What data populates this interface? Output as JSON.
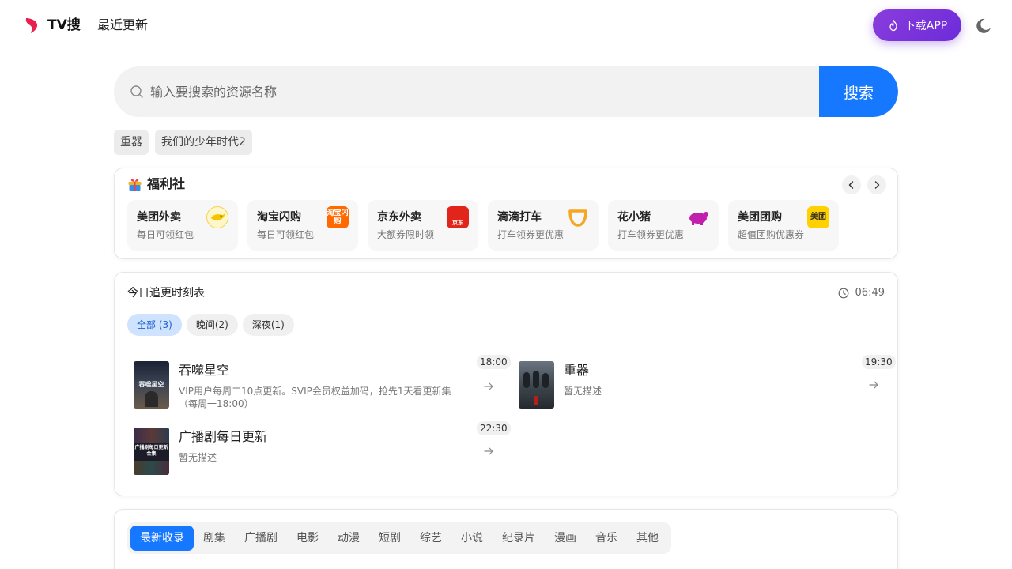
{
  "header": {
    "brand": "TV搜",
    "nav_recent": "最近更新",
    "download_label": "下载APP"
  },
  "search": {
    "placeholder": "输入要搜索的资源名称",
    "button": "搜索",
    "tags": [
      "重器",
      "我们的少年时代2"
    ]
  },
  "welfare": {
    "title": "福利社",
    "items": [
      {
        "name": "美团外卖",
        "desc": "每日可领红包",
        "logo": ""
      },
      {
        "name": "淘宝闪购",
        "desc": "每日可领红包",
        "logo": "淘宝闪购"
      },
      {
        "name": "京东外卖",
        "desc": "大额券限时领",
        "logo": "京东"
      },
      {
        "name": "滴滴打车",
        "desc": "打车领券更优惠",
        "logo": ""
      },
      {
        "name": "花小猪",
        "desc": "打车领券更优惠",
        "logo": ""
      },
      {
        "name": "美团团购",
        "desc": "超值团购优惠券",
        "logo": "美团"
      }
    ]
  },
  "schedule": {
    "title": "今日追更时刻表",
    "time": "06:49",
    "filters": [
      "全部 (3)",
      "晚间(2)",
      "深夜(1)"
    ],
    "shows": [
      {
        "title": "吞噬星空",
        "desc": "VIP用户每周二10点更新。SVIP会员权益加码，抢先1天看更新集（每周一18:00）",
        "time": "18:00",
        "poster_text": "吞噬星空"
      },
      {
        "title": "重器",
        "desc": "暂无描述",
        "time": "19:30",
        "poster_text": ""
      },
      {
        "title": "广播剧每日更新",
        "desc": "暂无描述",
        "time": "22:30",
        "poster_text": "广播剧每日更新合集"
      }
    ]
  },
  "categories": [
    "最新收录",
    "剧集",
    "广播剧",
    "电影",
    "动漫",
    "短剧",
    "综艺",
    "小说",
    "纪录片",
    "漫画",
    "音乐",
    "其他"
  ],
  "colors": {
    "accent": "#1677ff",
    "download_gradient": "#7b33db",
    "filter_active_bg": "#cfe3ff"
  }
}
